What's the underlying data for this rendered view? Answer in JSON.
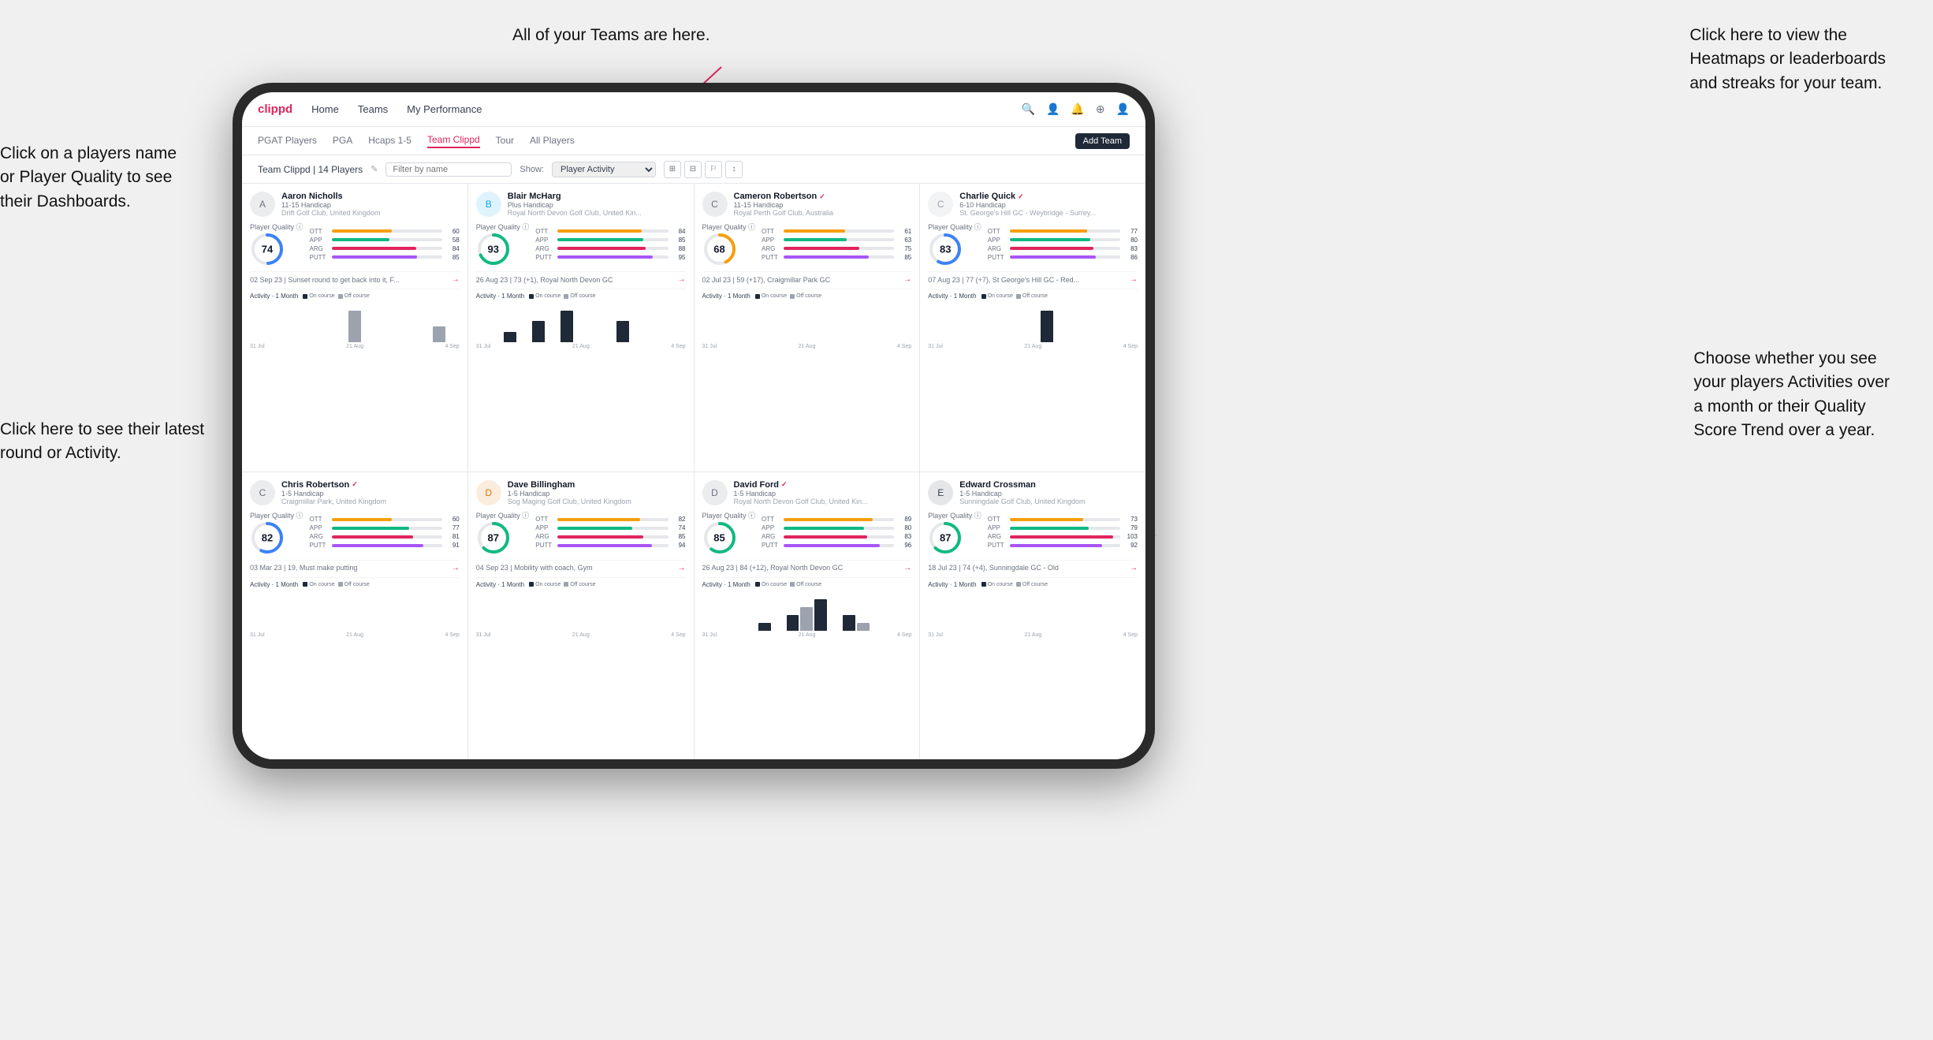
{
  "annotations": {
    "top_center": "All of your Teams are here.",
    "top_right": "Click here to view the\nHeatmaps or leaderboards\nand streaks for your team.",
    "left_top": "Click on a players name\nor Player Quality to see\ntheir Dashboards.",
    "left_bottom": "Click here to see their latest\nround or Activity.",
    "right_bottom": "Choose whether you see\nyour players Activities over\na month or their Quality\nScore Trend over a year."
  },
  "navbar": {
    "brand": "clippd",
    "items": [
      "Home",
      "Teams",
      "My Performance"
    ],
    "icons": [
      "🔍",
      "👤",
      "🔔",
      "⊕",
      "👤"
    ]
  },
  "subnav": {
    "items": [
      "PGAT Players",
      "PGA",
      "Hcaps 1-5",
      "Team Clippd",
      "Tour",
      "All Players"
    ],
    "active": "Team Clippd",
    "add_button": "Add Team"
  },
  "teambar": {
    "title": "Team Clippd | 14 Players",
    "search_placeholder": "Filter by name",
    "show_label": "Show:",
    "show_value": "Player Activity",
    "view_options": [
      "⊞",
      "⊟",
      "⚐",
      "↕"
    ]
  },
  "players": [
    {
      "name": "Aaron Nicholls",
      "handicap": "11-15 Handicap",
      "club": "Drift Golf Club, United Kingdom",
      "verified": false,
      "quality": 74,
      "quality_color": "#3b82f6",
      "ott": 60,
      "app": 58,
      "arg": 84,
      "putt": 85,
      "last_round": "02 Sep 23 | Sunset round to get back into it, F...",
      "avatar_color": "#6b7280",
      "bars": [
        0,
        0,
        0,
        0,
        0,
        0,
        0,
        2,
        0,
        0,
        0,
        0,
        0,
        1,
        0
      ]
    },
    {
      "name": "Blair McHarg",
      "handicap": "Plus Handicap",
      "club": "Royal North Devon Golf Club, United Kin...",
      "verified": false,
      "quality": 93,
      "quality_color": "#10b981",
      "ott": 84,
      "app": 85,
      "arg": 88,
      "putt": 95,
      "last_round": "26 Aug 23 | 73 (+1), Royal North Devon GC",
      "avatar_color": "#0ea5e9",
      "bars": [
        0,
        0,
        1,
        0,
        2,
        0,
        3,
        0,
        0,
        0,
        2,
        0,
        0,
        0,
        0
      ]
    },
    {
      "name": "Cameron Robertson",
      "handicap": "11-15 Handicap",
      "club": "Royal Perth Golf Club, Australia",
      "verified": true,
      "quality": 68,
      "quality_color": "#f59e0b",
      "ott": 61,
      "app": 63,
      "arg": 75,
      "putt": 85,
      "last_round": "02 Jul 23 | 59 (+17), Craigmillar Park GC",
      "avatar_color": "#6b7280",
      "bars": [
        0,
        0,
        0,
        0,
        0,
        0,
        0,
        0,
        0,
        0,
        0,
        0,
        0,
        0,
        0
      ]
    },
    {
      "name": "Charlie Quick",
      "handicap": "6-10 Handicap",
      "club": "St. George's Hill GC - Weybridge - Surrey...",
      "verified": true,
      "quality": 83,
      "quality_color": "#3b82f6",
      "ott": 77,
      "app": 80,
      "arg": 83,
      "putt": 86,
      "last_round": "07 Aug 23 | 77 (+7), St George's Hill GC - Red...",
      "avatar_color": "#9ca3af",
      "bars": [
        0,
        0,
        0,
        0,
        0,
        0,
        0,
        0,
        1,
        0,
        0,
        0,
        0,
        0,
        0
      ]
    },
    {
      "name": "Chris Robertson",
      "handicap": "1-5 Handicap",
      "club": "Craigmillar Park, United Kingdom",
      "verified": true,
      "quality": 82,
      "quality_color": "#3b82f6",
      "ott": 60,
      "app": 77,
      "arg": 81,
      "putt": 91,
      "last_round": "03 Mar 23 | 19, Must make putting",
      "avatar_color": "#6b7280",
      "bars": [
        0,
        0,
        0,
        0,
        0,
        0,
        0,
        0,
        0,
        0,
        0,
        0,
        0,
        0,
        0
      ]
    },
    {
      "name": "Dave Billingham",
      "handicap": "1-5 Handicap",
      "club": "Sog Maging Golf Club, United Kingdom",
      "verified": false,
      "quality": 87,
      "quality_color": "#10b981",
      "ott": 82,
      "app": 74,
      "arg": 85,
      "putt": 94,
      "last_round": "04 Sep 23 | Mobility with coach, Gym",
      "avatar_color": "#d97706",
      "bars": [
        0,
        0,
        0,
        0,
        0,
        0,
        0,
        0,
        0,
        0,
        0,
        0,
        0,
        0,
        0
      ]
    },
    {
      "name": "David Ford",
      "handicap": "1-5 Handicap",
      "club": "Royal North Devon Golf Club, United Kin...",
      "verified": true,
      "quality": 85,
      "quality_color": "#10b981",
      "ott": 89,
      "app": 80,
      "arg": 83,
      "putt": 96,
      "last_round": "26 Aug 23 | 84 (+12), Royal North Devon GC",
      "avatar_color": "#6b7280",
      "bars": [
        0,
        0,
        0,
        0,
        1,
        0,
        2,
        3,
        4,
        0,
        2,
        1,
        0,
        0,
        0
      ]
    },
    {
      "name": "Edward Crossman",
      "handicap": "1-5 Handicap",
      "club": "Sunningdale Golf Club, United Kingdom",
      "verified": false,
      "quality": 87,
      "quality_color": "#10b981",
      "ott": 73,
      "app": 79,
      "arg": 103,
      "putt": 92,
      "last_round": "18 Jul 23 | 74 (+4), Sunningdale GC - Old",
      "avatar_color": "#374151",
      "bars": [
        0,
        0,
        0,
        0,
        0,
        0,
        0,
        0,
        0,
        0,
        0,
        0,
        0,
        0,
        0
      ]
    }
  ],
  "stat_colors": {
    "ott": "#f59e0b",
    "app": "#10b981",
    "arg": "#e0245e",
    "putt": "#a855f7"
  },
  "activity": {
    "title": "Activity",
    "period": "1 Month",
    "on_course_color": "#1f2937",
    "off_course_color": "#9ca3af",
    "labels": [
      "31 Jul",
      "21 Aug",
      "4 Sep"
    ]
  }
}
